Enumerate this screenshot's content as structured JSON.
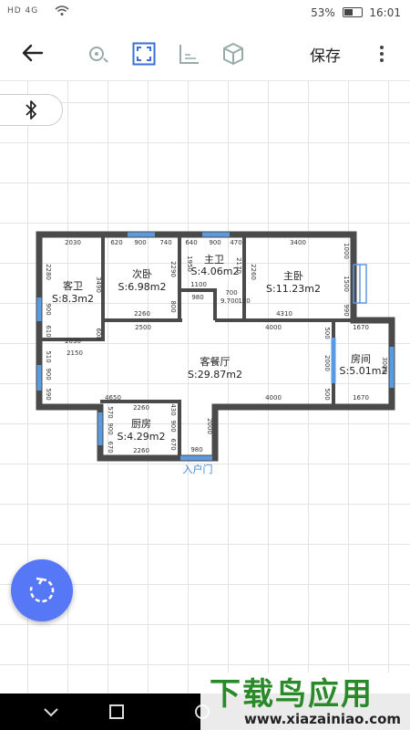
{
  "status_bar": {
    "carrier_left": "HD 4G",
    "battery": "53%",
    "time": "16:01"
  },
  "toolbar": {
    "save_label": "保存",
    "icons": [
      "back-arrow-icon",
      "rotate-view-icon",
      "fit-screen-icon",
      "ruler-icon",
      "3d-cube-icon",
      "more-vert-icon"
    ]
  },
  "floor_plan": {
    "rooms": [
      {
        "name": "客卫",
        "area": "S:8.3m2"
      },
      {
        "name": "次卧",
        "area": "S:6.98m2"
      },
      {
        "name": "主卫",
        "area": "S:4.06m2"
      },
      {
        "name": "主卧",
        "area": "S:11.23m2"
      },
      {
        "name": "客餐厅",
        "area": "S:29.87m2"
      },
      {
        "name": "房间",
        "area": "S:5.01m2"
      },
      {
        "name": "厨房",
        "area": "S:4.29m2"
      }
    ],
    "entrance_label": "入户门",
    "dimensions": {
      "top_1": "2030",
      "top_2": "620",
      "top_3": "900",
      "top_4": "740",
      "top_5": "640",
      "top_6": "900",
      "top_7": "470",
      "top_8": "3400",
      "left_1": "2280",
      "left_2": "900",
      "left_3": "610",
      "bottom_kewei": "2030",
      "left_4": "2150",
      "left_5": "510",
      "left_6": "900",
      "left_7": "590",
      "cw_right": "3490",
      "cw_b": "600",
      "cw2_right": "2290",
      "cw2_b": "800",
      "cw2_bottom": "2260",
      "mw_left": "1950",
      "mw_right": "2170",
      "mw_1100": "1100",
      "mw_980": "980",
      "mw_700": "700",
      "mw_9700": "9.700",
      "mw_120": "120",
      "mb_left": "2260",
      "mb_1000": "1000",
      "mb_1500": "1500",
      "mb_990": "990",
      "mb_bottom": "4310",
      "liv_2500": "2500",
      "liv_4000": "4000",
      "liv_4650": "4650",
      "liv_4000b": "4000",
      "r_1670": "1670",
      "r_2000": "2000",
      "r_500": "500",
      "r_500b": "500",
      "r_3000": "3000",
      "r_1670b": "1670",
      "k_2260": "2260",
      "k_570": "570",
      "k_900": "900",
      "k_670": "670",
      "k_2260b": "2260",
      "k_430": "430",
      "k_900b": "900",
      "k_670b": "670",
      "e_2000": "2000",
      "e_980": "980"
    }
  },
  "watermark": {
    "title": "下载鸟应用",
    "url": "www.xiazainiao.com"
  }
}
